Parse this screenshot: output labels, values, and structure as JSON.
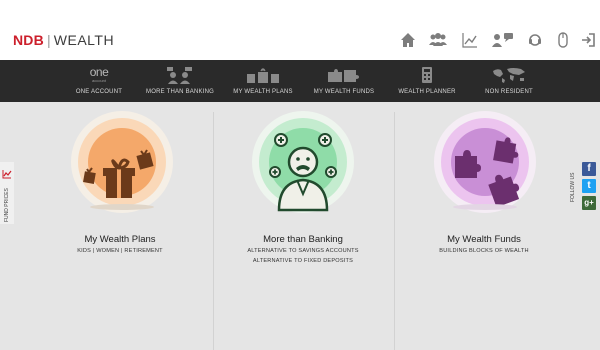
{
  "brand": {
    "name_primary": "NDB",
    "name_secondary": "WEALTH",
    "primary_color": "#cc1f2b"
  },
  "header_icons": [
    "home-icon",
    "group-icon",
    "chart-icon",
    "contact-chat-icon",
    "support-icon",
    "mouse-icon",
    "login-icon"
  ],
  "nav": {
    "items": [
      {
        "label": "ONE ACCOUNT",
        "icon": "one-account-icon",
        "icon_text": "one",
        "icon_subtext": "account"
      },
      {
        "label": "MORE THAN BANKING",
        "icon": "people-chat-icon"
      },
      {
        "label": "MY WEALTH PLANS",
        "icon": "gifts-icon"
      },
      {
        "label": "MY WEALTH FUNDS",
        "icon": "puzzle-icon"
      },
      {
        "label": "WEALTH PLANNER",
        "icon": "calculator-icon"
      },
      {
        "label": "NON RESIDENT",
        "icon": "world-map-icon"
      }
    ]
  },
  "panels": [
    {
      "title": "My Wealth Plans",
      "lines": [
        "KIDS | WOMEN | RETIREMENT"
      ],
      "icon": "gifts-icon",
      "accent": "#f4a86a"
    },
    {
      "title": "More than Banking",
      "lines": [
        "ALTERNATIVE TO SAVINGS ACCOUNTS",
        "ALTERNATIVE TO FIXED DEPOSITS"
      ],
      "icon": "banker-icon",
      "accent": "#8fdca8"
    },
    {
      "title": "My Wealth Funds",
      "lines": [
        "BUILDING BLOCKS OF WEALTH"
      ],
      "icon": "puzzle-icon",
      "accent": "#c98fd6"
    }
  ],
  "side_tab": {
    "label": "FUND PRICES",
    "icon": "chart-icon"
  },
  "follow": {
    "label": "FOLLOW US",
    "networks": [
      "f",
      "t",
      "g+"
    ]
  }
}
